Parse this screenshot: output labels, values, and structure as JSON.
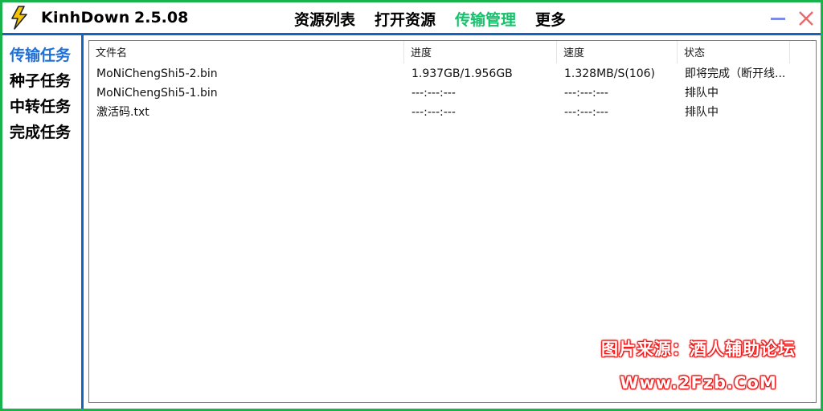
{
  "app": {
    "name": "KinhDown",
    "version": "2.5.08"
  },
  "topnav": {
    "items": [
      {
        "label": "资源列表"
      },
      {
        "label": "打开资源"
      },
      {
        "label": "传输管理"
      },
      {
        "label": "更多"
      }
    ],
    "active": "传输管理"
  },
  "sidebar": {
    "items": [
      {
        "label": "传输任务"
      },
      {
        "label": "种子任务"
      },
      {
        "label": "中转任务"
      },
      {
        "label": "完成任务"
      }
    ],
    "active": "传输任务"
  },
  "table": {
    "columns": [
      "文件名",
      "进度",
      "速度",
      "状态"
    ],
    "rows": [
      {
        "name": "MoNiChengShi5-2.bin",
        "progress": "1.937GB/1.956GB",
        "speed": "1.328MB/S(106)",
        "status": "即将完成（断开线..."
      },
      {
        "name": "MoNiChengShi5-1.bin",
        "progress": "---:---:---",
        "speed": "---:---:---",
        "status": "排队中"
      },
      {
        "name": "激活码.txt",
        "progress": "---:---:---",
        "speed": "---:---:---",
        "status": "排队中"
      }
    ]
  },
  "watermark": {
    "line1": "图片来源：酒人辅助论坛",
    "line2": "Www.2Fzb.CoM"
  },
  "colors": {
    "window_border": "#19b34b",
    "divider": "#1565c0",
    "active_nav": "#14c26a",
    "active_side": "#1e6fd9",
    "close_icon": "#e86a6a",
    "minimize_icon": "#7f89e6"
  },
  "icons": [
    "lightning-logo-icon",
    "minimize-icon",
    "close-icon"
  ]
}
